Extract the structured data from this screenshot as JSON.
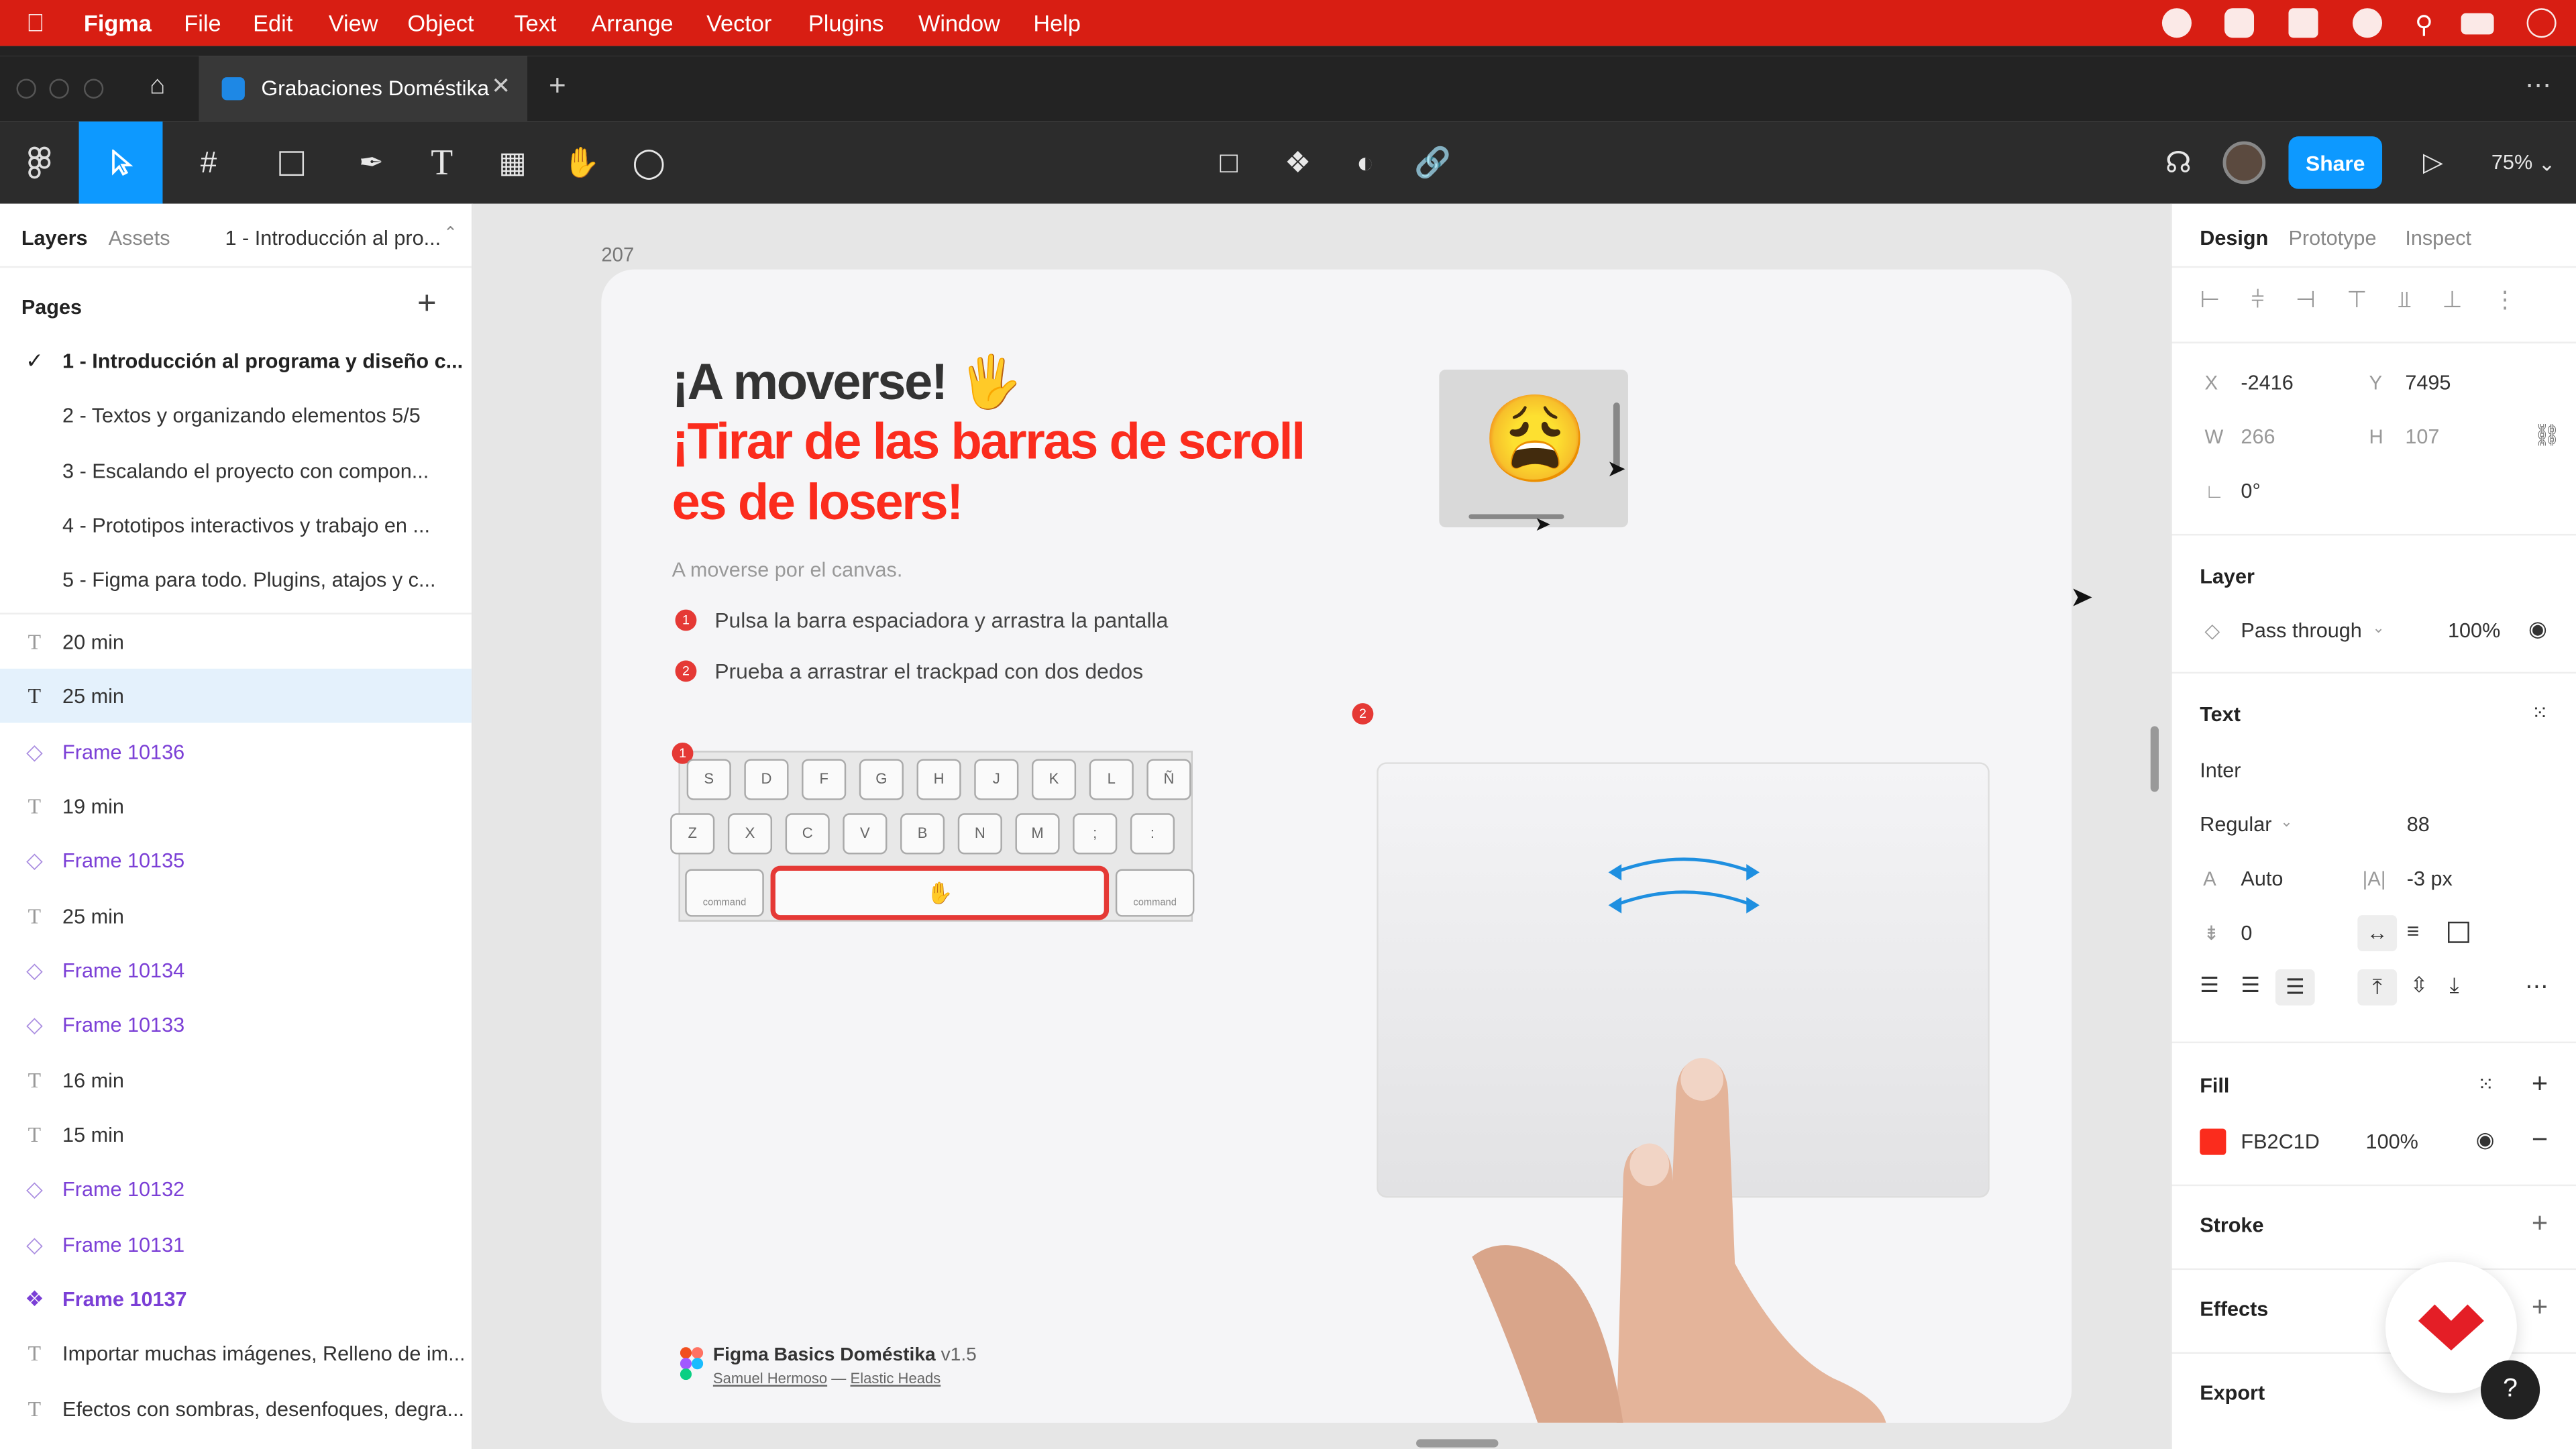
{
  "menubar": {
    "app": "Figma",
    "items": [
      "File",
      "Edit",
      "View",
      "Object",
      "Text",
      "Arrange",
      "Vector",
      "Plugins",
      "Window",
      "Help"
    ]
  },
  "tab": {
    "title": "Grabaciones Doméstika"
  },
  "toolbar": {
    "share_label": "Share",
    "zoom": "75%"
  },
  "left": {
    "tabs": {
      "layers": "Layers",
      "assets": "Assets",
      "page_select": "1 - Introducción al pro..."
    },
    "pages_title": "Pages",
    "pages": [
      "1 - Introducción al programa y diseño c...",
      "2 - Textos y organizando elementos 5/5",
      "3 - Escalando el proyecto con compon...",
      "4 - Prototipos interactivos y trabajo en ...",
      "5 - Figma para todo. Plugins, atajos y c..."
    ],
    "layers": [
      {
        "name": "20 min",
        "type": "text"
      },
      {
        "name": "25 min",
        "type": "text"
      },
      {
        "name": "Frame 10136",
        "type": "frame"
      },
      {
        "name": "19 min",
        "type": "text"
      },
      {
        "name": "Frame 10135",
        "type": "frame"
      },
      {
        "name": "25 min",
        "type": "text"
      },
      {
        "name": "Frame 10134",
        "type": "frame"
      },
      {
        "name": "Frame 10133",
        "type": "frame"
      },
      {
        "name": "16 min",
        "type": "text"
      },
      {
        "name": "15 min",
        "type": "text"
      },
      {
        "name": "Frame 10132",
        "type": "frame"
      },
      {
        "name": "Frame 10131",
        "type": "frame"
      },
      {
        "name": "Frame 10137",
        "type": "component"
      },
      {
        "name": "Importar muchas imágenes, Relleno de im...",
        "type": "text"
      },
      {
        "name": "Efectos con sombras, desenfoques, degra...",
        "type": "text"
      }
    ]
  },
  "canvas": {
    "frame_label": "207",
    "title_line1": "¡A moverse! 🖐",
    "title_line2": "¡Tirar de las barras de scroll",
    "title_line3": "es de losers!",
    "subtitle": "A moverse por el canvas.",
    "step1": "Pulsa la barra espaciadora y arrastra la pantalla",
    "step2": "Prueba a arrastrar el trackpad con dos dedos",
    "num1": "1",
    "num2": "2",
    "emoji": "😩",
    "keys_row1": [
      "S",
      "D",
      "F",
      "G",
      "H",
      "J",
      "K",
      "L",
      "Ñ"
    ],
    "keys_row2": [
      "Z",
      "X",
      "C",
      "V",
      "B",
      "N",
      "M",
      ";",
      ":"
    ],
    "command_label": "command",
    "footer_title": "Figma Basics Doméstika",
    "footer_version": "v1.5",
    "footer_author": "Samuel Hermoso",
    "footer_sep": "—",
    "footer_company": "Elastic Heads"
  },
  "right": {
    "tabs": {
      "design": "Design",
      "prototype": "Prototype",
      "inspect": "Inspect"
    },
    "x_label": "X",
    "x": "-2416",
    "y_label": "Y",
    "y": "7495",
    "w_label": "W",
    "w": "266",
    "h_label": "H",
    "h": "107",
    "rotation": "0°",
    "layer_title": "Layer",
    "blend": "Pass through",
    "opacity": "100%",
    "text_title": "Text",
    "font": "Inter",
    "weight": "Regular",
    "size": "88",
    "line_height": "Auto",
    "letter_spacing": "-3 px",
    "paragraph": "0",
    "fill_title": "Fill",
    "fill_hex": "FB2C1D",
    "fill_opacity": "100%",
    "stroke_title": "Stroke",
    "effects_title": "Effects",
    "export_title": "Export",
    "help": "?"
  },
  "colors": {
    "menubar": "#d81e13",
    "accent": "#0d99ff",
    "fill": "#FB2C1D",
    "frame_purple": "#7b3fd6"
  }
}
